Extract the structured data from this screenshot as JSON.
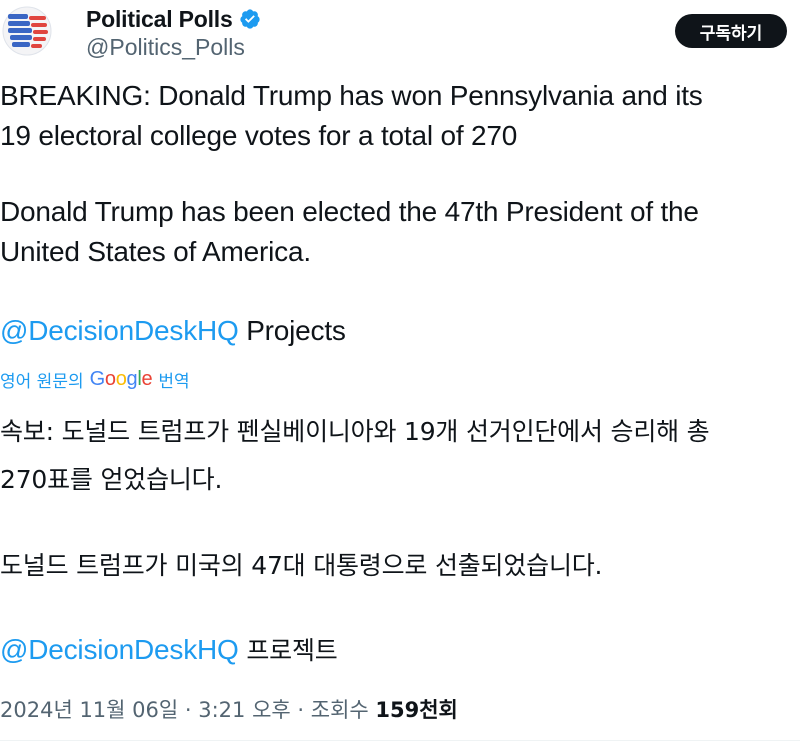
{
  "author": {
    "display_name": "Political Polls",
    "handle": "@Politics_Polls",
    "avatar_icon": "ballot-flag-avatar",
    "verified_icon": "verified-badge-icon",
    "verified_color": "#1d9bf0"
  },
  "header": {
    "subscribe_label": "구독하기"
  },
  "tweet": {
    "line1": "BREAKING: Donald Trump has won Pennsylvania and its",
    "line2": "19 electoral college votes for a total of 270",
    "line3": "Donald Trump has been elected the 47th President of the",
    "line4": "United States of America.",
    "mention": "@DecisionDeskHQ",
    "mention_suffix": " Projects"
  },
  "translation": {
    "prefix": "영어 원문의",
    "google": "Google",
    "suffix": "번역",
    "line1": "속보: 도널드 트럼프가 펜실베이니아와 19개 선거인단에서 승리해 총",
    "line2": "270표를 얻었습니다.",
    "line3": "도널드 트럼프가 미국의 47대 대통령으로 선출되었습니다.",
    "mention": "@DecisionDeskHQ",
    "mention_suffix": " 프로젝트"
  },
  "meta": {
    "date": "2024년 11월 06일",
    "separator": " · ",
    "time": "3:21 오후",
    "views_label": "조회수",
    "views_count": "159천회"
  },
  "colors": {
    "link": "#1d9bf0",
    "text": "#0f1419",
    "muted": "#536471",
    "button_bg": "#0f1419"
  }
}
